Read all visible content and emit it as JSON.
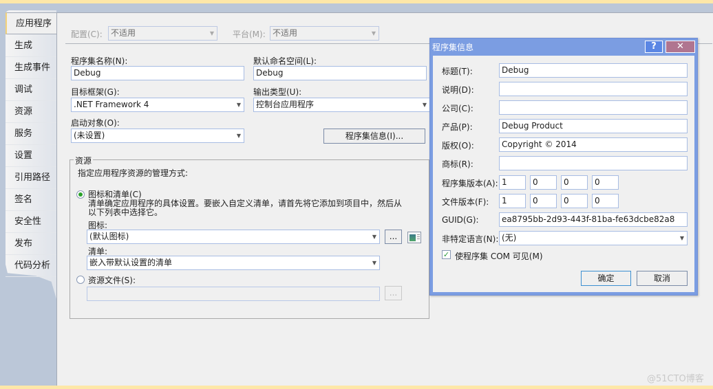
{
  "tabs": [
    {
      "label": "应用程序",
      "active": true
    },
    {
      "label": "生成"
    },
    {
      "label": "生成事件"
    },
    {
      "label": "调试"
    },
    {
      "label": "资源"
    },
    {
      "label": "服务"
    },
    {
      "label": "设置"
    },
    {
      "label": "引用路径"
    },
    {
      "label": "签名"
    },
    {
      "label": "安全性"
    },
    {
      "label": "发布"
    },
    {
      "label": "代码分析"
    }
  ],
  "config": {
    "configuration_label": "配置(C):",
    "configuration_value": "不适用",
    "platform_label": "平台(M):",
    "platform_value": "不适用"
  },
  "app": {
    "assembly_name_label": "程序集名称(N):",
    "assembly_name_value": "Debug",
    "default_namespace_label": "默认命名空间(L):",
    "default_namespace_value": "Debug",
    "target_framework_label": "目标框架(G):",
    "target_framework_value": ".NET Framework 4",
    "output_type_label": "输出类型(U):",
    "output_type_value": "控制台应用程序",
    "startup_object_label": "启动对象(O):",
    "startup_object_value": "(未设置)",
    "assembly_info_button": "程序集信息(I)..."
  },
  "resources": {
    "group_title": "资源",
    "description": "指定应用程序资源的管理方式:",
    "icon_manifest_option": "图标和清单(C)",
    "icon_manifest_selected": true,
    "icon_manifest_help_line1": "清单确定应用程序的具体设置。要嵌入自定义清单，请首先将它添加到项目中，然后从",
    "icon_manifest_help_line2": "以下列表中选择它。",
    "icon_label": "图标:",
    "icon_value": "(默认图标)",
    "browse_button": "...",
    "manifest_label": "清单:",
    "manifest_value": "嵌入带默认设置的清单",
    "resource_file_option": "资源文件(S):",
    "resource_file_selected": false,
    "resource_file_value": "",
    "resource_browse_button": "..."
  },
  "dialog": {
    "title": "程序集信息",
    "help_button": "?",
    "close_button": "✕",
    "fields": {
      "title_label": "标题(T):",
      "title_value": "Debug",
      "description_label": "说明(D):",
      "description_value": "",
      "company_label": "公司(C):",
      "company_value": "",
      "product_label": "产品(P):",
      "product_value": "Debug Product",
      "copyright_label": "版权(O):",
      "copyright_value": "Copyright ©  2014",
      "trademark_label": "商标(R):",
      "trademark_value": "",
      "assembly_version_label": "程序集版本(A):",
      "assembly_version": [
        "1",
        "0",
        "0",
        "0"
      ],
      "file_version_label": "文件版本(F):",
      "file_version": [
        "1",
        "0",
        "0",
        "0"
      ],
      "guid_label": "GUID(G):",
      "guid_value": "ea8795bb-2d93-443f-81ba-fe63dcbe82a8",
      "neutral_language_label": "非特定语言(N):",
      "neutral_language_value": "(无)",
      "com_visible_label": "使程序集 COM 可见(M)",
      "com_visible_checked": true
    },
    "ok_button": "确定",
    "cancel_button": "取消"
  },
  "watermark": "@51CTO博客"
}
